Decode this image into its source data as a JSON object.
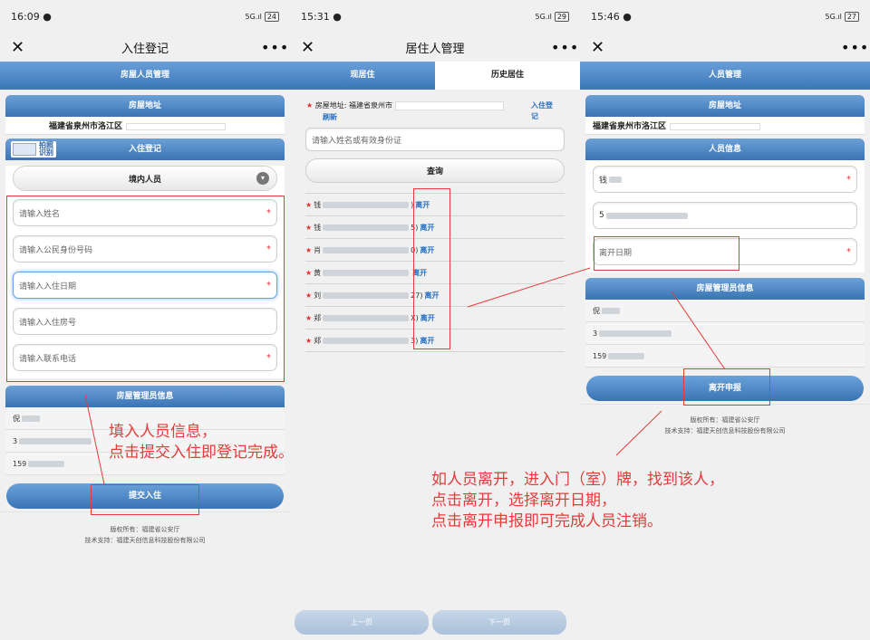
{
  "panel1": {
    "time": "16:09",
    "battery": "24",
    "title": "入住登记",
    "bluebar": "房屋人员管理",
    "address_head": "房屋地址",
    "address": "福建省泉州市洛江区",
    "photo_label": "拍照识别",
    "checkin_head": "入住登记",
    "person_type": "境内人员",
    "fields": [
      "请输入姓名",
      "请输入公民身份号码",
      "请输入入住日期",
      "请输入入住房号",
      "请输入联系电话"
    ],
    "manager_head": "房屋管理员信息",
    "manager_name": "倪",
    "manager_id": "3",
    "manager_phone": "159",
    "submit": "提交入住",
    "copyright": "版权所有：福建省公安厅",
    "support": "技术支持：福建天创信息科技股份有限公司"
  },
  "panel2": {
    "time": "15:31",
    "battery": "29",
    "title": "居住人管理",
    "tab_current": "现居住",
    "tab_history": "历史居住",
    "address_label": "房屋地址: 福建省泉州市",
    "checkin_link": "入住登记",
    "refresh": "刷新",
    "search_placeholder": "请输入姓名或有效身份证",
    "search_btn": "查询",
    "rows": [
      {
        "prefix": "钱",
        "tail": ")",
        "action": "离开"
      },
      {
        "prefix": "钱",
        "tail": "5)",
        "action": "离开"
      },
      {
        "prefix": "肖",
        "tail": "0)",
        "action": "离开"
      },
      {
        "prefix": "黄",
        "tail": "",
        "action": "离开"
      },
      {
        "prefix": "刘",
        "tail": "27)",
        "action": "离开"
      },
      {
        "prefix": "郑",
        "tail": "X)",
        "action": "离开"
      },
      {
        "prefix": "郑",
        "tail": "3)",
        "action": "离开"
      }
    ],
    "prev": "上一页",
    "next": "下一页"
  },
  "panel3": {
    "time": "15:46",
    "battery": "27",
    "bluebar": "人员管理",
    "address_head": "房屋地址",
    "address": "福建省泉州市洛江区",
    "person_head": "人员信息",
    "name_value": "钱",
    "id_value": "5",
    "leave_date_placeholder": "离开日期",
    "manager_head": "房屋管理员信息",
    "manager_name": "倪",
    "manager_id": "3",
    "manager_phone": "159",
    "leave_submit": "离开申报",
    "copyright": "版权所有：福建省公安厅",
    "support": "技术支持：福建天创信息科技股份有限公司"
  },
  "annotations": {
    "left_line1": "填入人员信息，",
    "left_line2": "点击提交入住即登记完成。",
    "right_line1": "如人员离开，进入门（室）牌，找到该人，",
    "right_line2": "点击离开，选择离开日期，",
    "right_line3": "点击离开申报即可完成人员注销。"
  }
}
